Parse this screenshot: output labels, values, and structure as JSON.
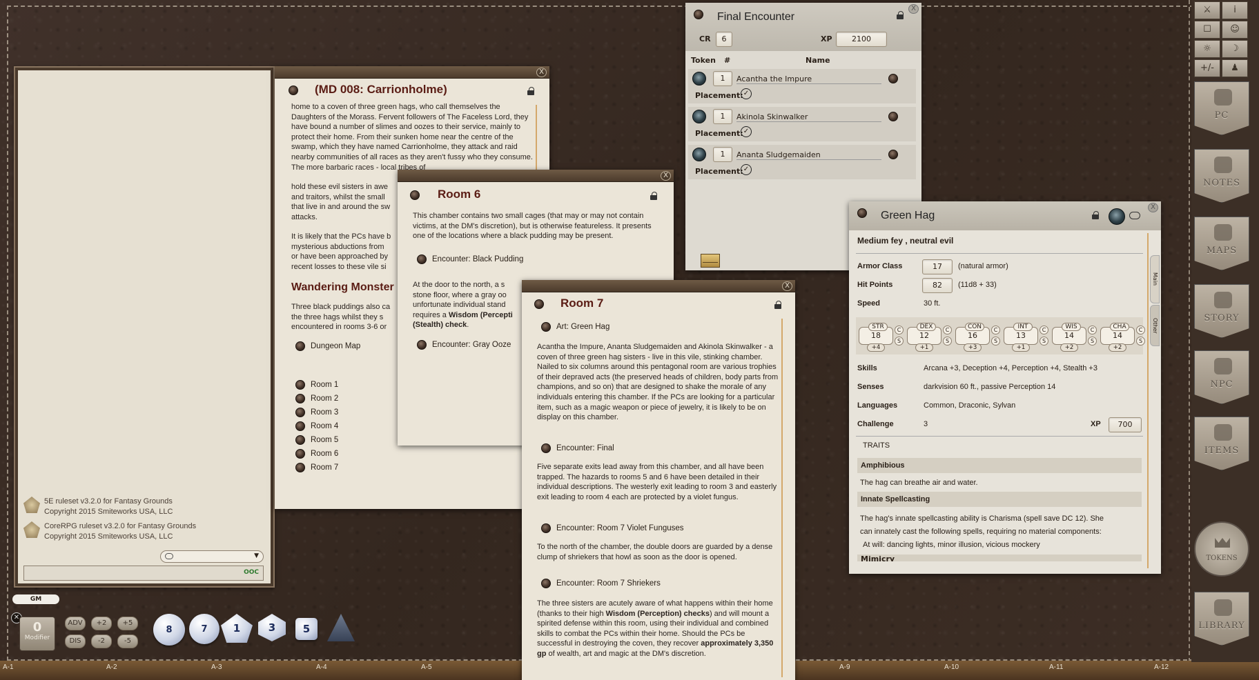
{
  "chat": {
    "messages": [
      {
        "line1": "5E ruleset v3.2.0 for Fantasy Grounds",
        "line2": "Copyright 2015 Smiteworks USA, LLC"
      },
      {
        "line1": "CoreRPG ruleset v3.2.0 for Fantasy Grounds",
        "line2": "Copyright 2015 Smiteworks USA, LLC"
      }
    ],
    "ooc_label": "OOC",
    "gm_label": "GM"
  },
  "modifier": {
    "value": "0",
    "label": "Modifier"
  },
  "roll_buttons": {
    "adv": "ADV",
    "dis": "DIS",
    "p2": "+2",
    "p5": "+5",
    "m2": "-2",
    "m5": "-5"
  },
  "dice": [
    "8",
    "7",
    "1",
    "3",
    "5",
    ""
  ],
  "grid_labels": [
    "A-1",
    "A-2",
    "A-3",
    "A-4",
    "A-5",
    "A-9",
    "A-10",
    "A-11",
    "A-12"
  ],
  "carrionholme": {
    "title": "(MD 008: Carrionholme)",
    "para1": "home to a coven of three green hags, who call themselves the Daughters of the Morass. Fervent followers of The Faceless Lord, they have bound a number of slimes and oozes to their service, mainly to protect their home. From their sunken home near the centre of the swamp, which they have named Carrionholme, they attack and raid nearby communities of all races as they aren't fussy who they consume. The more barbaric races - local tribes of",
    "para1b": "hold these evil sisters in awe",
    "para1c": "and traitors, whilst the small",
    "para1d": "that live in and around the sw",
    "para1e": "attacks.",
    "para2a": "It is likely that the PCs have b",
    "para2b": "mysterious abductions from",
    "para2c": "or have been approached by",
    "para2d": "recent losses to these vile si",
    "heading": "Wandering Monster",
    "para3a": "Three black puddings also ca",
    "para3b": "the three hags whilst they s",
    "para3c": "encountered in rooms 3-6 or",
    "dungeon_map": "Dungeon Map",
    "rooms": [
      "Room 1",
      "Room 2",
      "Room 3",
      "Room 4",
      "Room 5",
      "Room 6",
      "Room 7"
    ]
  },
  "room6": {
    "title": "Room 6",
    "desc": "This chamber contains two small cages (that may or may not contain victims, at the DM's discretion), but is otherwise featureless. It presents one of the locations where a black pudding may be present.",
    "encounter1": "Encounter: Black Pudding",
    "p2a": "At the door to the north, a s",
    "p2b": "stone floor, where a gray oo",
    "p2c": "unfortunate individual stand",
    "p2d": "requires a ",
    "p2d_bold": "Wisdom (Percepti",
    "p2e_bold": "(Stealth) check",
    "p2e": ".",
    "encounter2": "Encounter: Gray Ooze"
  },
  "room7": {
    "title": "Room 7",
    "art": "Art: Green Hag",
    "p1": "Acantha the Impure, Ananta Sludgemaiden and Akinola Skinwalker - a coven of three green hag sisters - live in this vile, stinking chamber. Nailed to six columns around this pentagonal room are various trophies of their depraved acts (the preserved heads of children, body parts from champions, and so on) that are designed to shake the morale of any individuals entering this chamber. If the PCs are looking for a particular item, such as a magic weapon or piece of jewelry, it is likely to be on display on this chamber.",
    "enc1": "Encounter: Final",
    "p2": "Five separate exits lead away from this chamber, and all have been trapped. The hazards to rooms 5 and 6 have been detailed in their individual descriptions. The westerly exit leading to room 3 and easterly exit leading to room 4 each are protected by a violet fungus.",
    "enc2": "Encounter: Room 7 Violet Funguses",
    "p3": "To the north of the chamber, the double doors are guarded by a dense clump of shriekers that howl as soon as the door is opened.",
    "enc3": "Encounter: Room 7 Shriekers",
    "p4a": "The three sisters are acutely aware of what happens within their home (thanks to their high ",
    "p4b": "Wisdom (Perception) checks",
    "p4c": ") and will mount a spirited defense within this room, using their individual and combined skills to combat the PCs within their home. Should the PCs be successful in destroying the coven, they recover ",
    "p4d": "approximately 3,350 gp",
    "p4e": " of wealth, art and magic at the DM's discretion."
  },
  "encounter": {
    "title": "Final Encounter",
    "cr_label": "CR",
    "cr": "6",
    "xp_label": "XP",
    "xp": "2100",
    "col_token": "Token",
    "col_num": "#",
    "col_name": "Name",
    "placement_label": "Placement:",
    "rows": [
      {
        "count": "1",
        "name": "Acantha the Impure"
      },
      {
        "count": "1",
        "name": "Akinola Skinwalker"
      },
      {
        "count": "1",
        "name": "Ananta Sludgemaiden"
      }
    ]
  },
  "hag": {
    "title": "Green Hag",
    "type": "Medium fey , neutral evil",
    "ac_label": "Armor Class",
    "ac": "17",
    "ac_note": "(natural armor)",
    "hp_label": "Hit Points",
    "hp": "82",
    "hp_note": "(11d8 + 33)",
    "speed_label": "Speed",
    "speed": "30 ft.",
    "stats": [
      {
        "name": "STR",
        "val": "18",
        "mod": "+4"
      },
      {
        "name": "DEX",
        "val": "12",
        "mod": "+1"
      },
      {
        "name": "CON",
        "val": "16",
        "mod": "+3"
      },
      {
        "name": "INT",
        "val": "13",
        "mod": "+1"
      },
      {
        "name": "WIS",
        "val": "14",
        "mod": "+2"
      },
      {
        "name": "CHA",
        "val": "14",
        "mod": "+2"
      }
    ],
    "cs_c": "C",
    "cs_s": "S",
    "skills_label": "Skills",
    "skills": "Arcana +3, Deception +4, Perception +4, Stealth +3",
    "senses_label": "Senses",
    "senses": "darkvision 60 ft., passive Perception 14",
    "lang_label": "Languages",
    "lang": "Common, Draconic, Sylvan",
    "chal_label": "Challenge",
    "chal": "3",
    "xp_label": "XP",
    "xp": "700",
    "traits_label": "TRAITS",
    "t1": "Amphibious",
    "t1d": "The hag can breathe air and water.",
    "t2": "Innate Spellcasting",
    "t2d1": "The hag's innate spellcasting ability is Charisma (spell save DC 12). She",
    "t2d2": "can innately cast the following spells, requiring no material components:",
    "t2d3": "At will: dancing lights, minor illusion, vicious mockery",
    "t3": "Mimicry",
    "tab_main": "Main",
    "tab_other": "Other"
  },
  "sidebar": {
    "buttons": [
      "PC",
      "NOTES",
      "MAPS",
      "STORY",
      "NPC",
      "ITEMS",
      "TOKENS",
      "LIBRARY"
    ],
    "toolbar": [
      "⚔",
      "i",
      "☐",
      "☺",
      "☼",
      "☽",
      "+/-",
      "♟"
    ]
  }
}
